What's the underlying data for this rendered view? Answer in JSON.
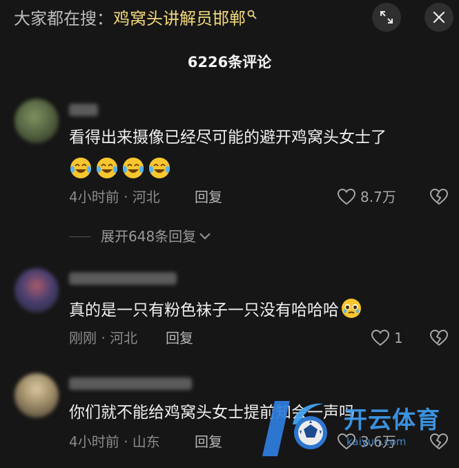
{
  "header": {
    "search_prefix": "大家都在搜：",
    "search_term": "鸡窝头讲解员邯郸",
    "comments_title": "6226条评论"
  },
  "icons": {
    "search": "search-icon",
    "expand": "expand-icon",
    "close": "close-icon",
    "like": "heart-icon",
    "dislike": "broken-heart-icon",
    "chevron": "chevron-down-icon",
    "laugh": "laughing-tears-emoji",
    "tear": "pleading-face-emoji"
  },
  "comments": [
    {
      "text": "看得出来摄像已经尽可能的避开鸡窝头女士了",
      "meta": "4小时前 · 河北",
      "reply": "回复",
      "likes": "8.7万",
      "emoji_count": 4
    },
    {
      "text": "真的是一只有粉色袜子一只没有哈哈哈",
      "meta": "刚刚 · 河北",
      "reply": "回复",
      "likes": "1"
    },
    {
      "text": "你们就不能给鸡窝头女士提前知会一声吗",
      "meta": "4小时前 · 山东",
      "reply": "回复",
      "likes": "3.6万"
    }
  ],
  "expand_replies": {
    "label": "展开648条回复"
  },
  "watermark": {
    "title": "开云体育",
    "url": "kaiyun.com"
  },
  "colors": {
    "background": "#161616",
    "highlight": "#f2d97c",
    "watermark": "#3f9cf0"
  }
}
